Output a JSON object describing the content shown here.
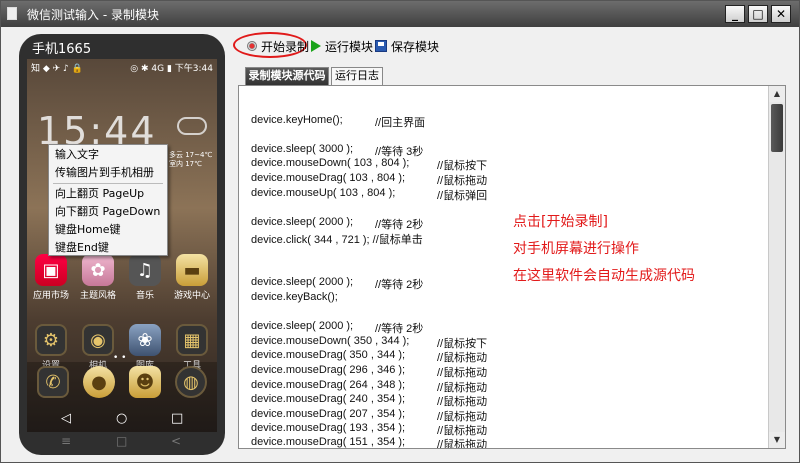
{
  "window": {
    "title": "微信测试输入 - 录制模块",
    "min_label": "_",
    "max_label": "□",
    "close_label": "✕"
  },
  "phone": {
    "label": "手机1665",
    "status_left": "知 ◆ ✈ ♪ 🔒",
    "status_right": "◎ ✱ 4G ▮ 下午3:44",
    "clock": "15:44",
    "weather": "多云 17~4℃ 室内 17℃",
    "apps_row1": [
      "应用市场",
      "主题风格",
      "音乐",
      "游戏中心"
    ],
    "apps_row2": [
      "设置",
      "相机",
      "图库",
      "工具"
    ],
    "dots": "• •",
    "nav_buttons": [
      "◁",
      "○",
      "□"
    ],
    "hw_nav": [
      "≡",
      "□",
      "<"
    ]
  },
  "context_menu": {
    "items": [
      "输入文字",
      "传输图片到手机相册",
      "向上翻页 PageUp",
      "向下翻页 PageDown",
      "键盘Home键",
      "键盘End键"
    ]
  },
  "toolbar": {
    "record_label": "开始录制",
    "run_label": "运行模块",
    "save_label": "保存模块"
  },
  "tabs": {
    "source_label": "录制模块源代码",
    "log_label": "运行日志"
  },
  "code": {
    "lines": [
      {
        "stmt": "device.keyHome();",
        "cmt": "//回主界面"
      },
      {
        "stmt": "device.sleep( 3000 );",
        "cmt": "//等待 3秒"
      },
      {
        "stmt": "device.mouseDown( 103 , 804 );",
        "cmt": "//鼠标按下"
      },
      {
        "stmt": "device.mouseDrag( 103 , 804 );",
        "cmt": "//鼠标拖动"
      },
      {
        "stmt": "device.mouseUp( 103 , 804 );",
        "cmt": "//鼠标弹回"
      },
      {
        "stmt": "device.sleep( 2000 );",
        "cmt": "//等待 2秒"
      },
      {
        "stmt": "device.click( 344 , 721 ); //鼠标单击",
        "cmt": ""
      },
      {
        "stmt": "device.sleep( 2000 );",
        "cmt": "//等待 2秒"
      },
      {
        "stmt": "device.keyBack();",
        "cmt": ""
      },
      {
        "stmt": "device.sleep( 2000 );",
        "cmt": "//等待 2秒"
      },
      {
        "stmt": "device.mouseDown( 350 , 344 );",
        "cmt": "//鼠标按下"
      },
      {
        "stmt": "device.mouseDrag( 350 , 344 );",
        "cmt": "//鼠标拖动"
      },
      {
        "stmt": "device.mouseDrag( 296 , 346 );",
        "cmt": "//鼠标拖动"
      },
      {
        "stmt": "device.mouseDrag( 264 , 348 );",
        "cmt": "//鼠标拖动"
      },
      {
        "stmt": "device.mouseDrag( 240 , 354 );",
        "cmt": "//鼠标拖动"
      },
      {
        "stmt": "device.mouseDrag( 207 , 354 );",
        "cmt": "//鼠标拖动"
      },
      {
        "stmt": "device.mouseDrag( 193 , 354 );",
        "cmt": "//鼠标拖动"
      },
      {
        "stmt": "device.mouseDrag( 151 , 354 );",
        "cmt": "//鼠标拖动"
      }
    ]
  },
  "annotations": [
    "点击[开始录制]",
    "对手机屏幕进行操作",
    "在这里软件会自动生成源代码"
  ],
  "scrollbar": {
    "up": "▲",
    "down": "▼"
  }
}
